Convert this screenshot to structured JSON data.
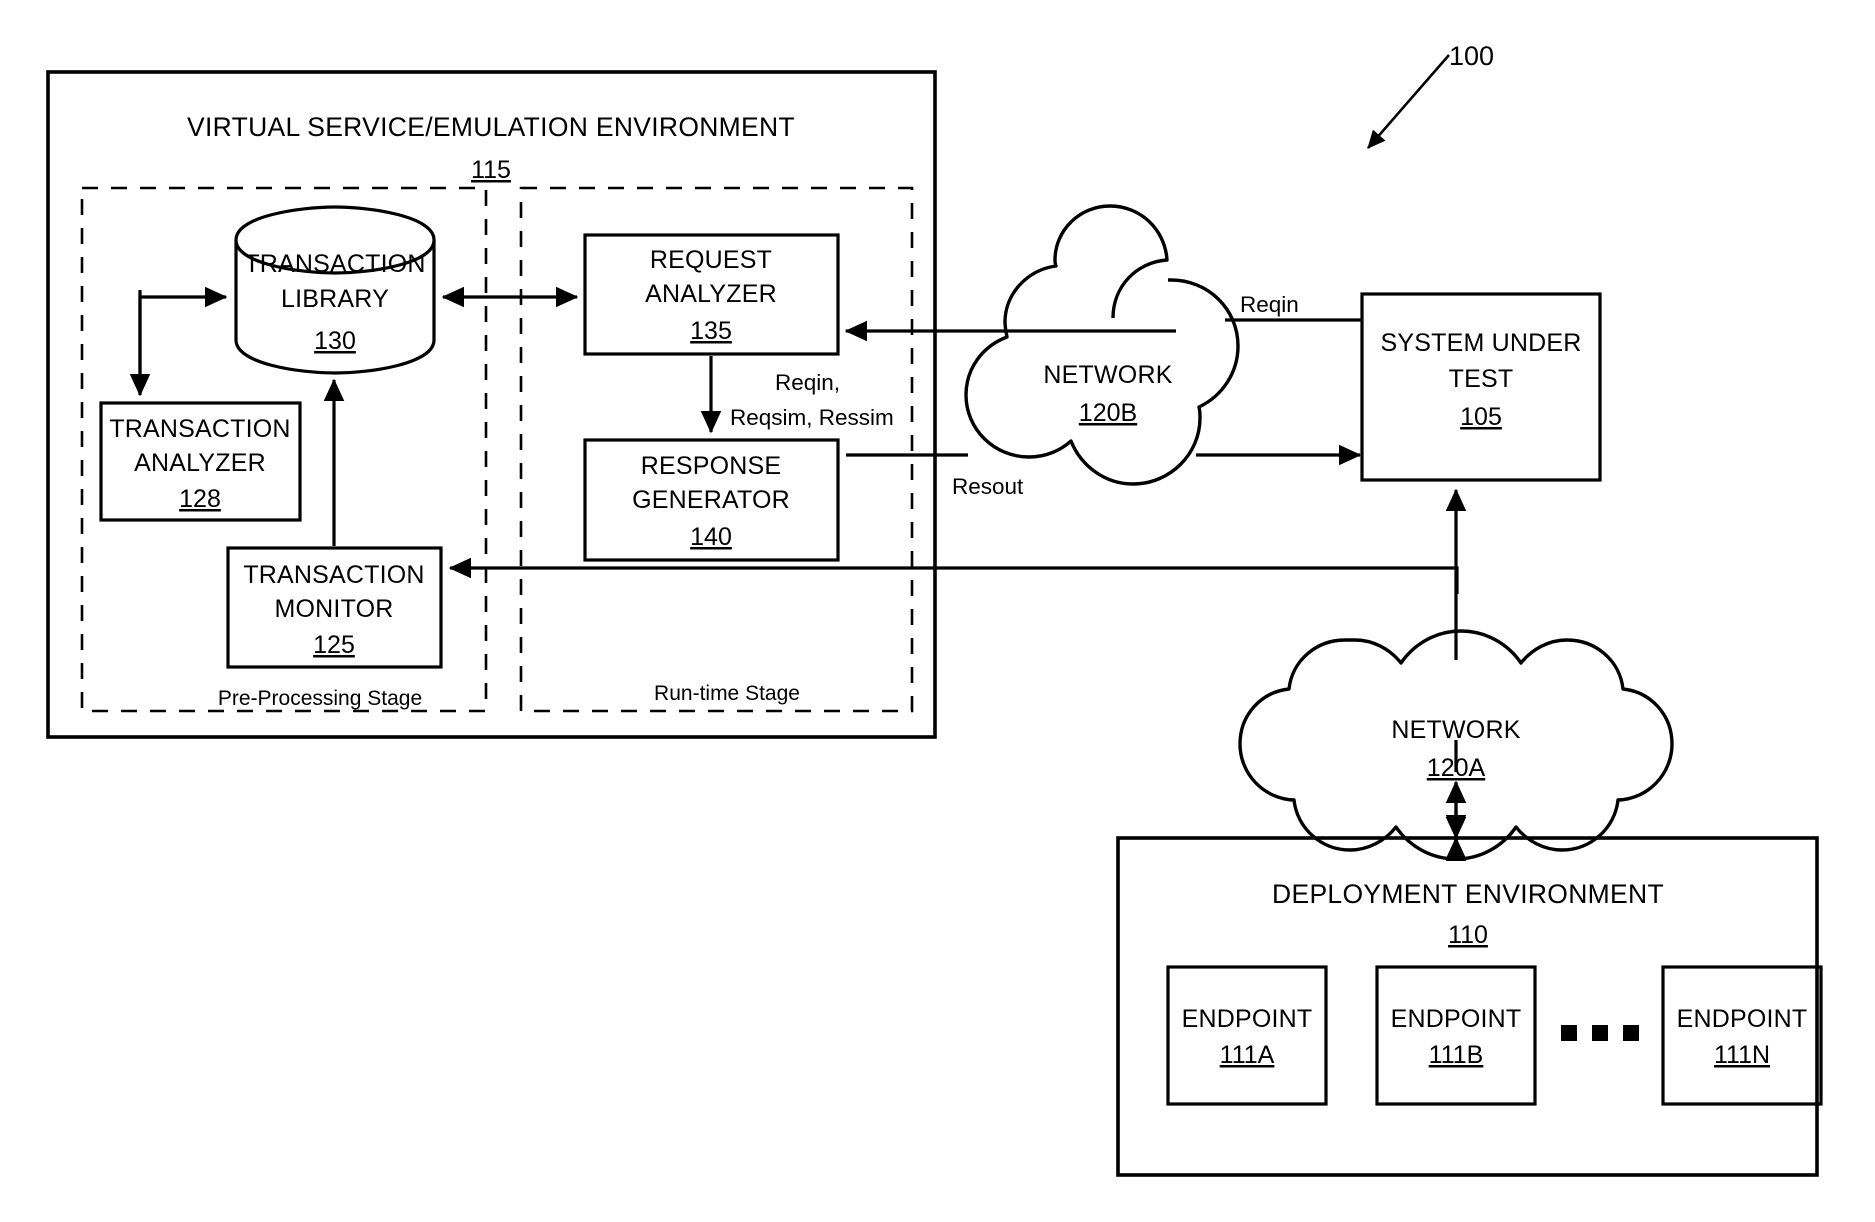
{
  "figure": {
    "number": "100",
    "caption_arrow": "figure-lead-arrow"
  },
  "virtual_env": {
    "title": "VIRTUAL SERVICE/EMULATION ENVIRONMENT",
    "ref": "115",
    "stages": {
      "pre_processing": "Pre-Processing Stage",
      "runtime": "Run-time Stage"
    },
    "components": [
      {
        "name": "transaction-library",
        "shape": "cylinder",
        "line1": "TRANSACTION",
        "line2": "LIBRARY",
        "ref": "130"
      },
      {
        "name": "transaction-analyzer",
        "shape": "rect",
        "line1": "TRANSACTION",
        "line2": "ANALYZER",
        "ref": "128"
      },
      {
        "name": "transaction-monitor",
        "shape": "rect",
        "line1": "TRANSACTION",
        "line2": "MONITOR",
        "ref": "125"
      },
      {
        "name": "request-analyzer",
        "shape": "rect",
        "line1": "REQUEST",
        "line2": "ANALYZER",
        "ref": "135"
      },
      {
        "name": "response-generator",
        "shape": "rect",
        "line1": "RESPONSE",
        "line2": "GENERATOR",
        "ref": "140"
      }
    ]
  },
  "networks": [
    {
      "name": "network-120b",
      "label": "NETWORK",
      "ref": "120B"
    },
    {
      "name": "network-120a",
      "label": "NETWORK",
      "ref": "120A"
    }
  ],
  "system_under_test": {
    "line1": "SYSTEM UNDER",
    "line2": "TEST",
    "ref": "105"
  },
  "deployment_env": {
    "title": "DEPLOYMENT ENVIRONMENT",
    "ref": "110",
    "ellipsis": "• • •",
    "endpoints": [
      {
        "label": "ENDPOINT",
        "ref": "111A"
      },
      {
        "label": "ENDPOINT",
        "ref": "111B"
      },
      {
        "label": "ENDPOINT",
        "ref": "111N"
      }
    ]
  },
  "flow_labels": {
    "reqin_network": "Reqin",
    "analyzer_out_line1": "Reqin,",
    "analyzer_out_line2": "Reqsim, Ressim",
    "resout": "Resout"
  },
  "colors": {
    "stroke": "#000000",
    "background": "#ffffff"
  }
}
